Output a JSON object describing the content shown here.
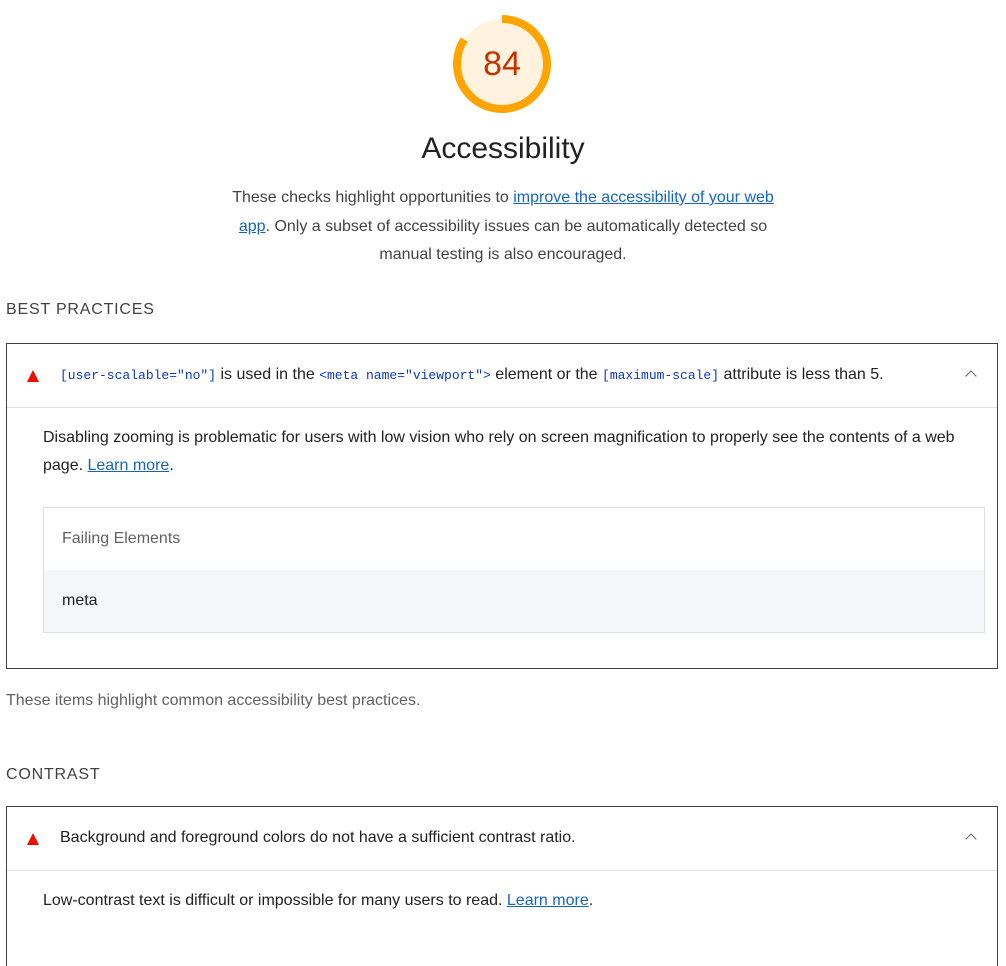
{
  "category": {
    "score": "84",
    "score_fraction": 0.84,
    "gauge_color": "#ffa400",
    "gauge_bg": "#fff3e0",
    "score_text_color": "#c33300",
    "title": "Accessibility",
    "desc_before_link": "These checks highlight opportunities to ",
    "desc_link": "improve the accessibility of your web app",
    "desc_after_link": ". Only a subset of accessibility issues can be automatically detected so manual testing is also encouraged."
  },
  "groups": [
    {
      "title": "BEST PRACTICES",
      "audit": {
        "status": "fail",
        "title_parts": [
          {
            "type": "code",
            "text": "[user-scalable=\"no\"]"
          },
          {
            "type": "text",
            "text": " is used in the "
          },
          {
            "type": "code",
            "text": "<meta name=\"viewport\">"
          },
          {
            "type": "text",
            "text": " element or the "
          },
          {
            "type": "code",
            "text": "[maximum-scale]"
          },
          {
            "type": "text",
            "text": " attribute is less than 5."
          }
        ],
        "description": "Disabling zooming is problematic for users with low vision who rely on screen magnification to properly see the contents of a web page. ",
        "learn_more": "Learn more",
        "table_header": "Failing Elements",
        "table_rows": [
          "meta"
        ]
      },
      "description": "These items highlight common accessibility best practices."
    },
    {
      "title": "CONTRAST",
      "audit": {
        "status": "fail",
        "title": "Background and foreground colors do not have a sufficient contrast ratio.",
        "description": "Low-contrast text is difficult or impossible for many users to read. ",
        "learn_more": "Learn more"
      }
    }
  ]
}
